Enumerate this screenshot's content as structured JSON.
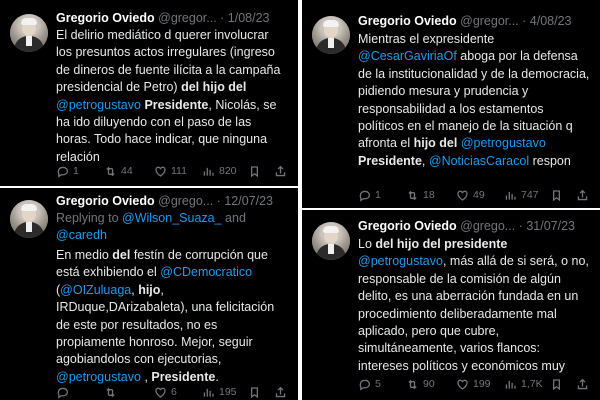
{
  "tweets": [
    {
      "name": "Gregorio Oviedo",
      "handle": "@gregor...",
      "date": "1/08/23",
      "segments": [
        {
          "t": "El delirio mediático d querer involucrar los presuntos actos irregulares (ingreso de dineros de fuente ilícita a la campaña presidencial de Petro) "
        },
        {
          "t": "del hijo del",
          "b": true
        },
        {
          "t": " "
        },
        {
          "t": "@petrogustavo",
          "m": true
        },
        {
          "t": " "
        },
        {
          "t": "Presidente",
          "b": true
        },
        {
          "t": ", Nicolás, se ha ido diluyendo con el paso de las horas. Todo hace indicar, que ninguna relación"
        }
      ],
      "stats": {
        "replies": "1",
        "retweets": "44",
        "likes": "111",
        "views": "820"
      }
    },
    {
      "name": "Gregorio Oviedo",
      "handle": "@gregor...",
      "date": "4/08/23",
      "segments": [
        {
          "t": "Mientras el expresidente "
        },
        {
          "t": "@CesarGaviriaOf",
          "m": true
        },
        {
          "t": " aboga por la defensa de la institucionalidad y de la democracia, pidiendo mesura y prudencia y responsabilidad a los estamentos políticos en el manejo de la situación q afronta el "
        },
        {
          "t": "hijo del",
          "b": true
        },
        {
          "t": " "
        },
        {
          "t": "@petrogustavo",
          "m": true
        },
        {
          "t": " "
        },
        {
          "t": "Presidente",
          "b": true
        },
        {
          "t": ", "
        },
        {
          "t": "@NoticiasCaracol",
          "m": true
        },
        {
          "t": " respon"
        }
      ],
      "stats": {
        "replies": "1",
        "retweets": "18",
        "likes": "49",
        "views": "747"
      }
    },
    {
      "name": "Gregorio Oviedo",
      "handle": "@grego...",
      "date": "12/07/23",
      "replying_prefix": "Replying to ",
      "replying_segments": [
        {
          "t": "@Wilson_Suaza_",
          "m": true
        },
        {
          "t": " and "
        },
        {
          "t": "@caredh",
          "m": true
        }
      ],
      "segments": [
        {
          "t": "En medio "
        },
        {
          "t": "del",
          "b": true
        },
        {
          "t": " festín de corrupción que está exhibiendo el "
        },
        {
          "t": "@CDemocratico",
          "m": true
        },
        {
          "t": " ("
        },
        {
          "t": "@OIZuluaga",
          "m": true
        },
        {
          "t": ", "
        },
        {
          "t": "hijo",
          "b": true
        },
        {
          "t": ", IRDuque,DArizabaleta), una felicitación de este por resultados, no es propiamente honroso. Mejor, seguir agobiandolos con ejecutorias, "
        },
        {
          "t": "@petrogustavo",
          "m": true
        },
        {
          "t": " , "
        },
        {
          "t": "Presidente",
          "b": true
        },
        {
          "t": "."
        }
      ],
      "stats": {
        "replies": "",
        "retweets": "",
        "likes": "6",
        "views": "195"
      }
    },
    {
      "name": "Gregorio Oviedo",
      "handle": "@grego...",
      "date": "31/07/23",
      "segments": [
        {
          "t": "Lo "
        },
        {
          "t": "del hijo del presidente",
          "b": true
        },
        {
          "t": " "
        },
        {
          "t": "@petrogustavo",
          "m": true
        },
        {
          "t": ", más allá de si será, o no, responsable de la comisión de algún delito, es una aberración fundada en un procedimiento deliberadamente mal aplicado, pero que cubre, simultáneamente, varios flancos: intereses políticos y económicos muy"
        }
      ],
      "stats": {
        "replies": "5",
        "retweets": "90",
        "likes": "199",
        "views": "1,7K"
      }
    }
  ],
  "colors": {
    "background": "#000000",
    "text": "#e7e9ea",
    "muted": "#71767b",
    "link": "#1d9bf0",
    "divider": "#ffffff"
  },
  "icons": [
    "avatar",
    "reply-icon",
    "retweet-icon",
    "like-icon",
    "views-icon",
    "bookmark-icon",
    "share-icon"
  ]
}
